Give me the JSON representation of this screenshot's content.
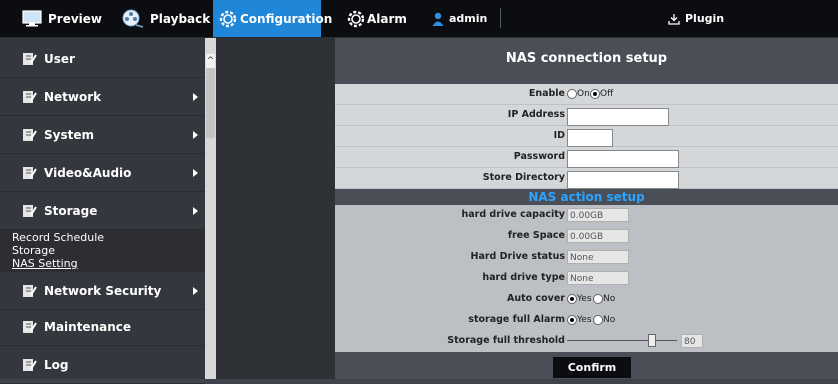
{
  "topbar": {
    "preview": "Preview",
    "playback": "Playback",
    "configuration": "Configuration",
    "alarm": "Alarm",
    "user": "admin",
    "plugin": "Plugin"
  },
  "sidebar": {
    "items": [
      {
        "label": "User"
      },
      {
        "label": "Network"
      },
      {
        "label": "System"
      },
      {
        "label": "Video&Audio"
      },
      {
        "label": "Storage"
      },
      {
        "label": "Network Security"
      },
      {
        "label": "Maintenance"
      },
      {
        "label": "Log"
      }
    ],
    "storage_sub": [
      "Record Schedule",
      "Storage",
      "NAS Setting"
    ]
  },
  "nas_connection": {
    "title": "NAS connection setup",
    "enable_label": "Enable",
    "enable_on": "On",
    "enable_off": "Off",
    "ip_label": "IP Address",
    "ip_value": "",
    "id_label": "ID",
    "id_value": "",
    "password_label": "Password",
    "password_value": "",
    "dir_label": "Store Directory",
    "dir_value": ""
  },
  "nas_action": {
    "title": "NAS action setup",
    "capacity_label": "hard drive capacity",
    "capacity_value": "0.00GB",
    "free_label": "free Space",
    "free_value": "0.00GB",
    "status_label": "Hard Drive status",
    "status_value": "None",
    "type_label": "hard drive type",
    "type_value": "None",
    "autocover_label": "Auto cover",
    "autocover_yes": "Yes",
    "autocover_no": "No",
    "fullalarm_label": "storage full Alarm",
    "fullalarm_yes": "Yes",
    "fullalarm_no": "No",
    "threshold_label": "Storage full threshold",
    "threshold_value": "80"
  },
  "confirm_label": "Confirm",
  "colors": {
    "accent": "#1f86d8",
    "subtitle_blue": "#2da4ff"
  }
}
